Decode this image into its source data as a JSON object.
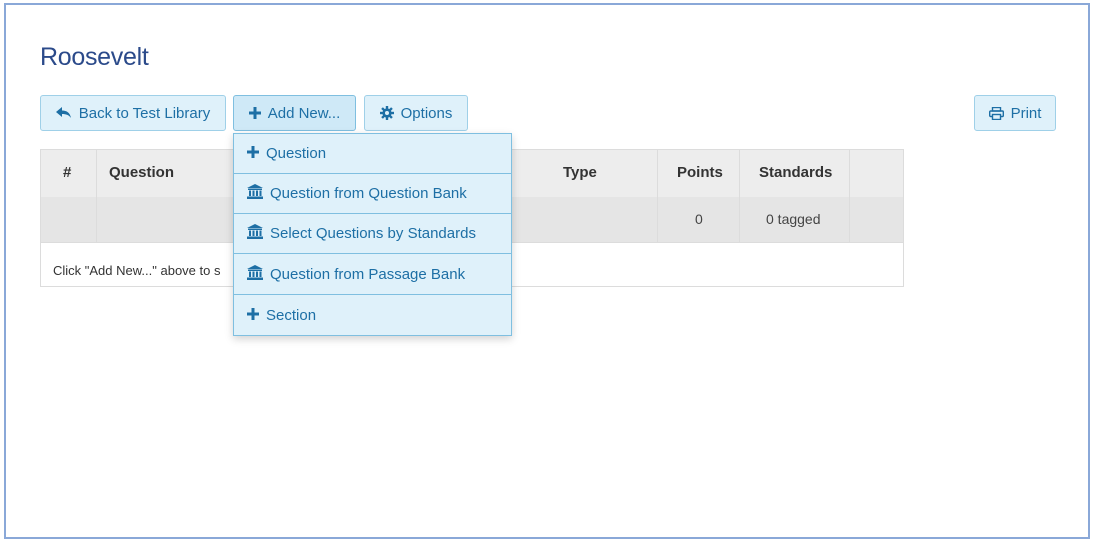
{
  "page": {
    "title": "Roosevelt"
  },
  "toolbar": {
    "back_label": "Back to Test Library",
    "add_new_label": "Add New...",
    "options_label": "Options",
    "print_label": "Print"
  },
  "table": {
    "headers": [
      "#",
      "Question",
      "Type",
      "Points",
      "Standards"
    ],
    "row": {
      "number": "",
      "question": "",
      "type": "",
      "points": "0",
      "standards": "0 tagged"
    },
    "empty_message": "Click \"Add New...\" above to s"
  },
  "add_menu": {
    "items": [
      {
        "label": "Question",
        "icon": "plus-icon"
      },
      {
        "label": "Question from Question Bank",
        "icon": "bank-icon"
      },
      {
        "label": "Select Questions by Standards",
        "icon": "bank-icon"
      },
      {
        "label": "Question from Passage Bank",
        "icon": "bank-icon"
      },
      {
        "label": "Section",
        "icon": "plus-icon"
      }
    ]
  },
  "colors": {
    "accent": "#1d6fa5",
    "title": "#2b4a8a",
    "button_bg": "#dff1fa",
    "border": "#9fd0e8"
  }
}
